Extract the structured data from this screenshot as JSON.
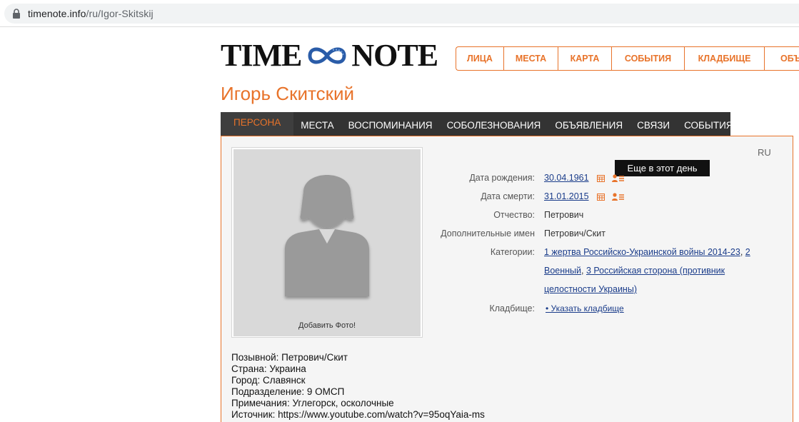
{
  "browser": {
    "url_host": "timenote.info",
    "url_path": "/ru/Igor-Skitskij"
  },
  "logo": {
    "left_word": "TIME",
    "right_word": "NOTE"
  },
  "top_nav": [
    {
      "label": "ЛИЦА"
    },
    {
      "label": "МЕСТА"
    },
    {
      "label": "КАРТА"
    },
    {
      "label": "СОБЫТИЯ"
    },
    {
      "label": "КЛАДБИЩЕ"
    },
    {
      "label": "ОБЪ"
    }
  ],
  "person": {
    "name": "Игорь Скитский"
  },
  "tabs": [
    {
      "label": "ПЕРСОНА",
      "active": true
    },
    {
      "label": "МЕСТА"
    },
    {
      "label": "ВОСПОМИНАНИЯ"
    },
    {
      "label": "СОБОЛЕЗНОВАНИЯ"
    },
    {
      "label": "ОБЪЯВЛЕНИЯ"
    },
    {
      "label": "СВЯЗИ"
    },
    {
      "label": "СОБЫТИЯ"
    }
  ],
  "lang": "RU",
  "photo": {
    "add_label": "Добавить Фото!"
  },
  "tooltip": "Еще в этот день",
  "info": {
    "birth_label": "Дата рождения:",
    "birth_value": "30.04.1961",
    "death_label": "Дата смерти:",
    "death_value": "31.01.2015",
    "patronymic_label": "Отчество:",
    "patronymic_value": "Петрович",
    "extra_names_label": "Дополнительные имен",
    "extra_names_value": "Петрович/Скит",
    "categories_label": "Категории:",
    "cat1": "1 жертва Российско-Украинской войны 2014-23",
    "cat2_num": "2",
    "cat2_rest": "Военный",
    "cat3_line1": "3 Российская сторона (противник",
    "cat3_line2": "целостности Украины)",
    "cemetery_label": "Кладбище:",
    "cemetery_value": "• Указать кладбище"
  },
  "bio": [
    "Позывной: Петрович/Скит",
    "Страна: Украина",
    "Город: Славянск",
    "Подразделение: 9 ОМСП",
    "Примечания: Углегорск, осколочные",
    "Источник: https://www.youtube.com/watch?v=95oqYaia-ms"
  ],
  "colors": {
    "accent": "#e8732a",
    "tab_bar": "#333333",
    "link": "#1a3c8a",
    "panel_bg": "#f5f5f5"
  }
}
